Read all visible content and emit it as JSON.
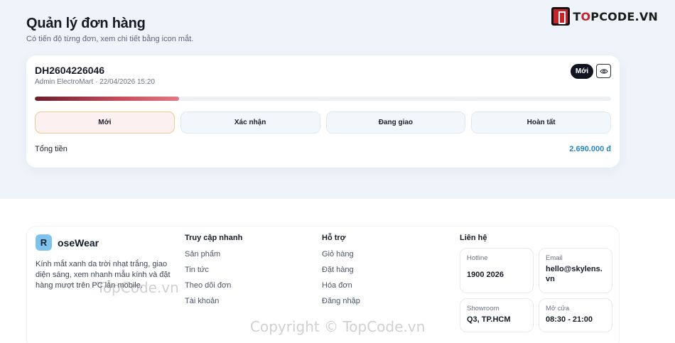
{
  "header": {
    "title": "Quản lý đơn hàng",
    "subtitle": "Có tiến độ từng đơn, xem chi tiết bằng icon mắt."
  },
  "brand_logo": {
    "text_prefix": "T",
    "text_accent": "O",
    "text_rest": "PCODE.VN",
    "colors": {
      "accent": "#c6232b"
    }
  },
  "order": {
    "id": "DH2604226046",
    "meta": "Admin ElectroMart · 22/04/2026 15:20",
    "status": "Mới",
    "progress": 0.25,
    "steps": [
      "Mới",
      "Xác nhận",
      "Đang giao",
      "Hoàn tất"
    ],
    "active_step": 0,
    "total_label": "Tổng tiền",
    "total_value": "2.690.000 đ"
  },
  "footer": {
    "brand_initial": "R",
    "brand_name": "oseWear",
    "brand_desc": "Kính mắt xanh da trời nhạt trắng, giao diện sáng, xem nhanh mẫu kính và đặt hàng mượt trên PC lẫn mobile.",
    "quick_links": {
      "title": "Truy cập nhanh",
      "items": [
        "Sản phẩm",
        "Tin tức",
        "Theo dõi đơn",
        "Tài khoản"
      ]
    },
    "support": {
      "title": "Hỗ trợ",
      "items": [
        "Giỏ hàng",
        "Đặt hàng",
        "Hóa đơn",
        "Đăng nhập"
      ]
    },
    "contact": {
      "title": "Liên hệ",
      "hotline_label": "Hotline",
      "hotline_value": "1900 2026",
      "email_label": "Email",
      "email_value": "hello@skylens.vn",
      "showroom_label": "Showroom",
      "showroom_value": "Q3, TP.HCM",
      "hours_label": "Mở cửa",
      "hours_value": "08:30 - 21:00"
    }
  },
  "watermarks": {
    "mid": "TopCode.vn",
    "bottom": "Copyright © TopCode.vn"
  },
  "icons": {
    "view": "eye-icon"
  }
}
